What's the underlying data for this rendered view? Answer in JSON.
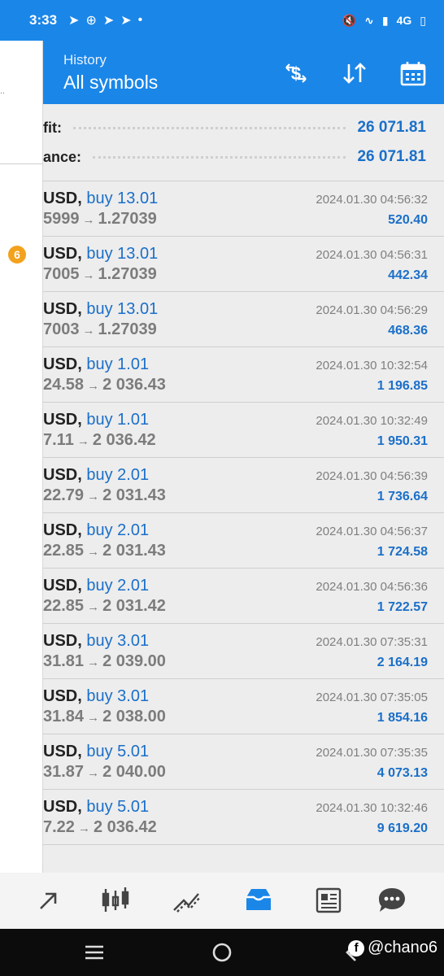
{
  "status_bar": {
    "time": "3:33",
    "network": "4G"
  },
  "header": {
    "subtitle": "History",
    "title": "All symbols",
    "actions": [
      {
        "name": "symbol-filter-icon"
      },
      {
        "name": "sort-icon"
      },
      {
        "name": "calendar-icon"
      }
    ]
  },
  "summary": [
    {
      "label": "fit:",
      "value": "26 071.81"
    },
    {
      "label": "ance:",
      "value": "26 071.81"
    }
  ],
  "trades": [
    {
      "symbol": "USD,",
      "side": "buy 13.01",
      "open": "5999",
      "close": "1.27039",
      "time": "2024.01.30 04:56:32",
      "profit": "520.40"
    },
    {
      "symbol": "USD,",
      "side": "buy 13.01",
      "open": "7005",
      "close": "1.27039",
      "time": "2024.01.30 04:56:31",
      "profit": "442.34"
    },
    {
      "symbol": "USD,",
      "side": "buy 13.01",
      "open": "7003",
      "close": "1.27039",
      "time": "2024.01.30 04:56:29",
      "profit": "468.36"
    },
    {
      "symbol": "USD,",
      "side": "buy 1.01",
      "open": "24.58",
      "close": "2 036.43",
      "time": "2024.01.30 10:32:54",
      "profit": "1 196.85"
    },
    {
      "symbol": "USD,",
      "side": "buy 1.01",
      "open": "7.11",
      "close": "2 036.42",
      "time": "2024.01.30 10:32:49",
      "profit": "1 950.31"
    },
    {
      "symbol": "USD,",
      "side": "buy 2.01",
      "open": "22.79",
      "close": "2 031.43",
      "time": "2024.01.30 04:56:39",
      "profit": "1 736.64"
    },
    {
      "symbol": "USD,",
      "side": "buy 2.01",
      "open": "22.85",
      "close": "2 031.43",
      "time": "2024.01.30 04:56:37",
      "profit": "1 724.58"
    },
    {
      "symbol": "USD,",
      "side": "buy 2.01",
      "open": "22.85",
      "close": "2 031.42",
      "time": "2024.01.30 04:56:36",
      "profit": "1 722.57"
    },
    {
      "symbol": "USD,",
      "side": "buy 3.01",
      "open": "31.81",
      "close": "2 039.00",
      "time": "2024.01.30 07:35:31",
      "profit": "2 164.19"
    },
    {
      "symbol": "USD,",
      "side": "buy 3.01",
      "open": "31.84",
      "close": "2 038.00",
      "time": "2024.01.30 07:35:05",
      "profit": "1 854.16"
    },
    {
      "symbol": "USD,",
      "side": "buy 5.01",
      "open": "31.87",
      "close": "2 040.00",
      "time": "2024.01.30 07:35:35",
      "profit": "4 073.13"
    },
    {
      "symbol": "USD,",
      "side": "buy 5.01",
      "open": "7.22",
      "close": "2 036.42",
      "time": "2024.01.30 10:32:46",
      "profit": "9 619.20"
    }
  ],
  "drawer": {
    "badge_count": "6"
  },
  "bottom_nav": [
    {
      "name": "nav-trade-icon"
    },
    {
      "name": "nav-chart-icon"
    },
    {
      "name": "nav-trending-icon"
    },
    {
      "name": "nav-history-icon",
      "active": true
    },
    {
      "name": "nav-news-icon"
    },
    {
      "name": "nav-chat-icon"
    }
  ],
  "watermark": {
    "text": "@chano6"
  },
  "colors": {
    "header_blue": "#1a86e8",
    "value_blue": "#1a6fc9",
    "list_background": "#ededed",
    "badge_orange": "#f3a21d"
  }
}
